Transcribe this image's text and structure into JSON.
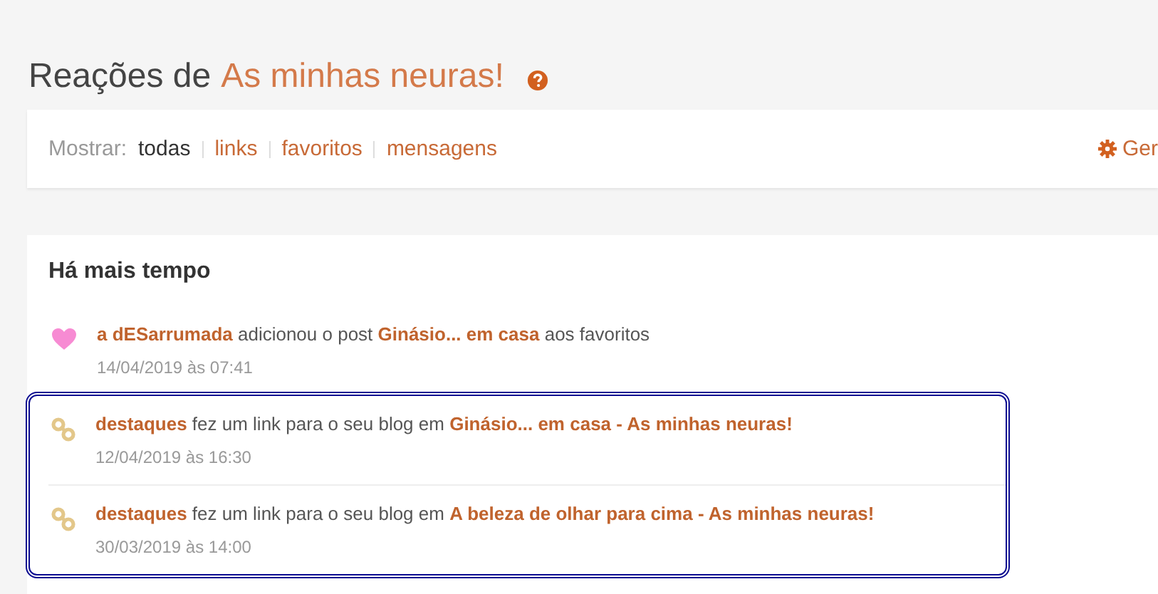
{
  "header": {
    "title_prefix": "Reações de",
    "blog_name": "As minhas neuras!"
  },
  "filter_bar": {
    "label": "Mostrar:",
    "options": [
      {
        "label": "todas",
        "selected": true
      },
      {
        "label": "links",
        "selected": false
      },
      {
        "label": "favoritos",
        "selected": false
      },
      {
        "label": "mensagens",
        "selected": false
      }
    ],
    "settings_link": "Ger"
  },
  "feed": {
    "heading": "Há mais tempo",
    "groups": [
      {
        "highlighted": false,
        "items": [
          {
            "kind": "favorite",
            "actor": "a dESarrumada",
            "action": "adicionou o post",
            "target": "Ginásio... em casa",
            "suffix": "aos favoritos",
            "time": "14/04/2019 às 07:41"
          }
        ]
      },
      {
        "highlighted": true,
        "items": [
          {
            "kind": "link",
            "actor": "destaques",
            "action": "fez um link para o seu blog em",
            "target": "Ginásio... em casa - As minhas neuras!",
            "time": "12/04/2019 às 16:30"
          },
          {
            "kind": "link",
            "actor": "destaques",
            "action": "fez um link para o seu blog em",
            "target": "A beleza de olhar para cima - As minhas neuras!",
            "time": "30/03/2019 às 14:00"
          }
        ]
      }
    ]
  }
}
